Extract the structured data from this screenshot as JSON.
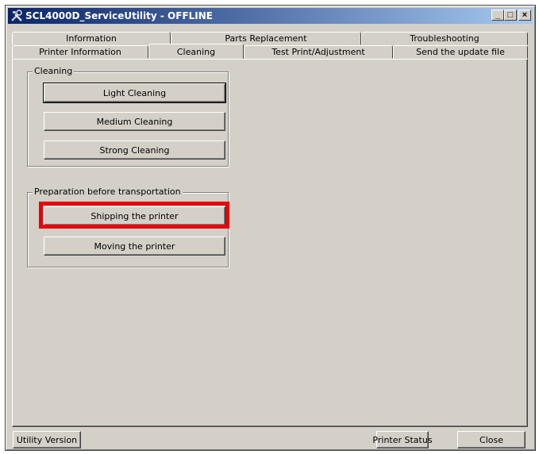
{
  "window": {
    "title": "SCL4000D_ServiceUtility - OFFLINE",
    "icon": "tools-icon",
    "controls": {
      "minimize": "_",
      "maximize": "□",
      "close": "×"
    }
  },
  "tabs": {
    "row1": [
      "Information",
      "Parts Replacement",
      "Troubleshooting"
    ],
    "row2": [
      "Printer Information",
      "Cleaning",
      "Test Print/Adjustment",
      "Send the update file"
    ],
    "active": "Cleaning"
  },
  "cleaning_group": {
    "label": "Cleaning",
    "buttons": [
      "Light Cleaning",
      "Medium Cleaning",
      "Strong Cleaning"
    ]
  },
  "transport_group": {
    "label": "Preparation before transportation",
    "buttons": [
      "Shipping the printer",
      "Moving the printer"
    ]
  },
  "footer": {
    "utility_version": "Utility Version",
    "printer_status": "Printer Status",
    "close": "Close"
  },
  "highlight_color": "#e8000b"
}
